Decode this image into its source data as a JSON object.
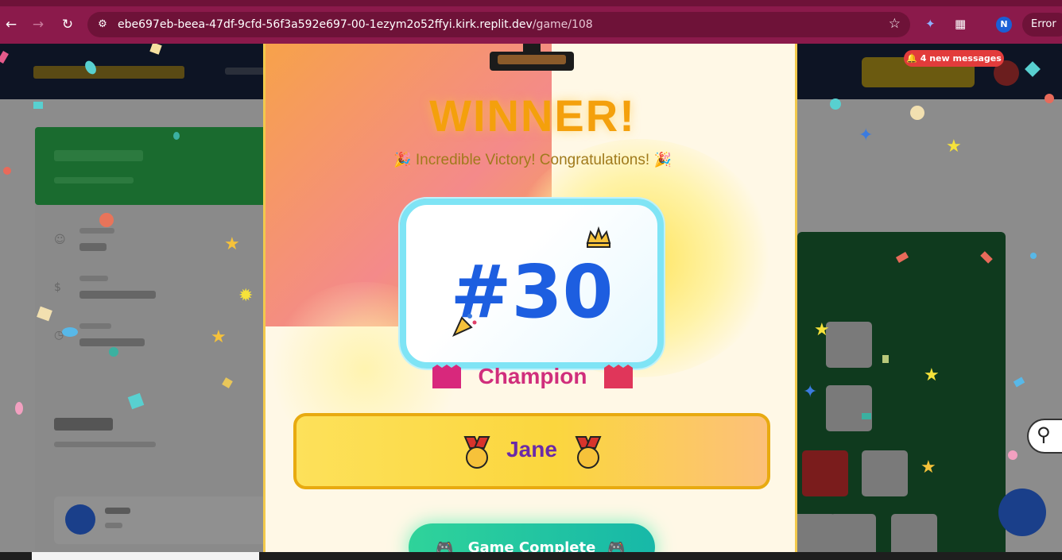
{
  "browser": {
    "url_host": "ebe697eb-beea-47df-9cfd-56f3a592e697-00-1ezym2o52ffyi.kirk.replit.dev",
    "url_path": "/game/108",
    "error_label": "Error",
    "profile_initial": "N"
  },
  "background_app": {
    "notification": "4 new messages"
  },
  "modal": {
    "title": "WINNER!",
    "subtitle": "Incredible Victory! Congratulations!",
    "rank": "#30",
    "rank_label": "Champion",
    "winner_name": "Jane",
    "primary_button": "Game Complete"
  },
  "colors": {
    "browser_frame": "#8b1a4b",
    "winner_title": "#f4a00c",
    "rank_number": "#1d5ee0",
    "champion_text": "#d02e7c",
    "winner_name": "#6a2aa8",
    "notification_badge": "#e23b3b",
    "button_gradient_start": "#2fd39a"
  },
  "icons": {
    "back": "arrow-left-icon",
    "forward": "arrow-right-icon",
    "reload": "reload-icon",
    "site_info": "site-settings-icon",
    "bookmark": "star-icon",
    "extension": "puzzle-icon",
    "party_popper": "party-popper-icon",
    "medal": "medal-icon",
    "ribbon": "ribbon-icon",
    "controller": "game-controller-icon"
  }
}
